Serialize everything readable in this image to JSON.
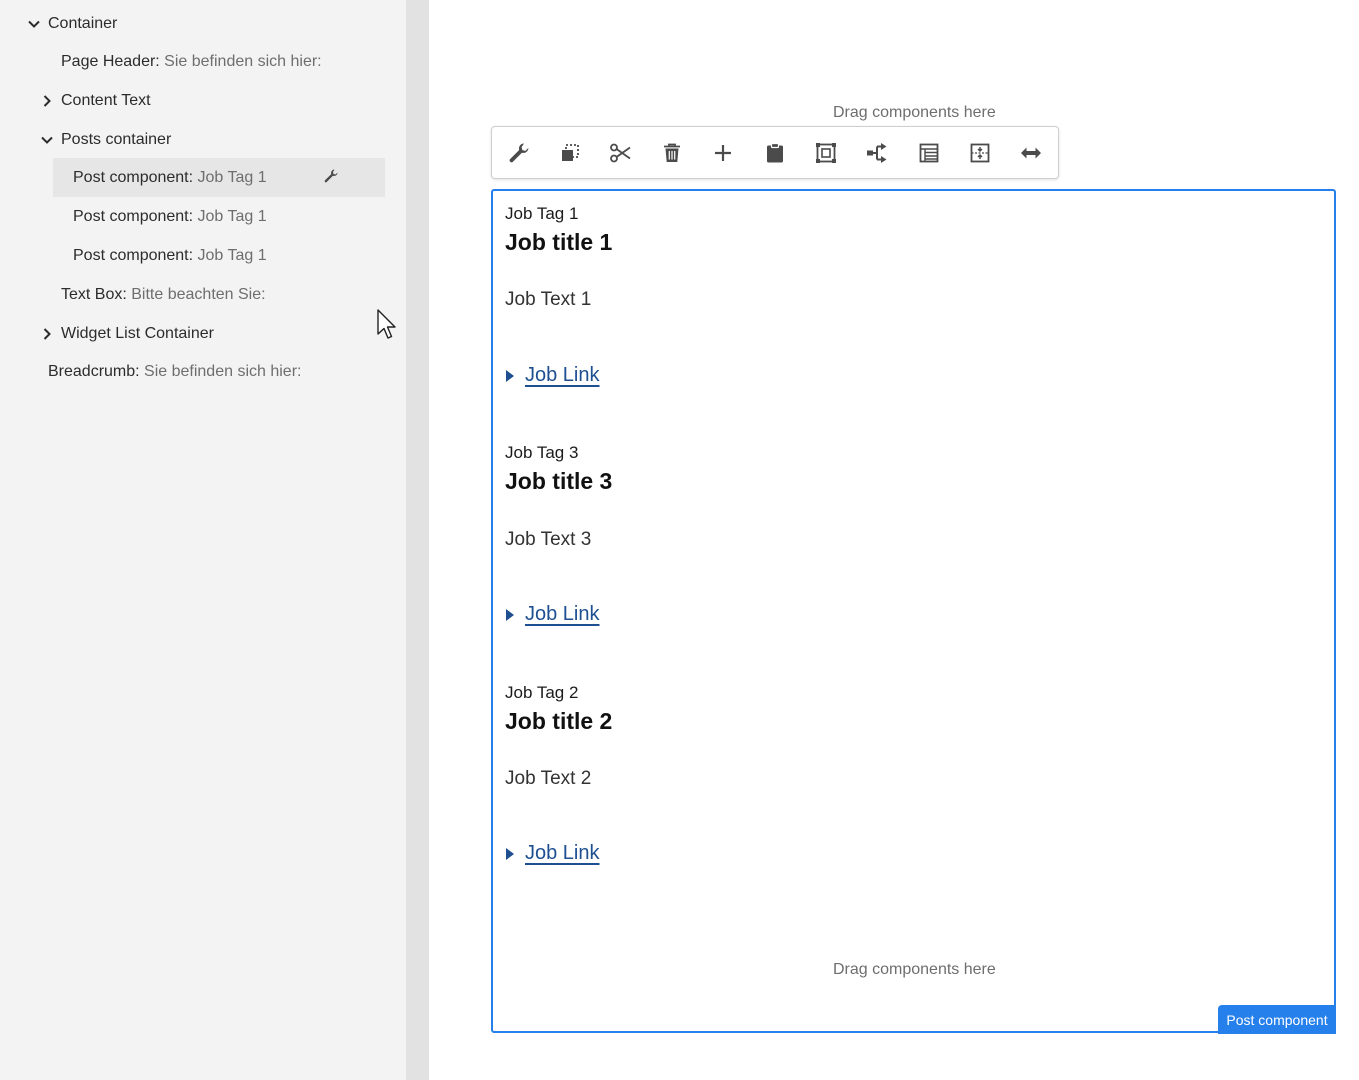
{
  "tree": {
    "rows": [
      {
        "name": "Container",
        "sub": ""
      },
      {
        "name": "Page Header:",
        "sub": " Sie befinden sich hier:"
      },
      {
        "name": "Content Text",
        "sub": ""
      },
      {
        "name": "Posts container",
        "sub": ""
      },
      {
        "name": "Post component:",
        "sub": " Job Tag 1"
      },
      {
        "name": "Post component:",
        "sub": " Job Tag 1"
      },
      {
        "name": "Post component:",
        "sub": " Job Tag 1"
      },
      {
        "name": "Text Box:",
        "sub": " Bitte beachten Sie:"
      },
      {
        "name": "Widget List Container",
        "sub": ""
      },
      {
        "name": "Breadcrumb:",
        "sub": " Sie befinden sich hier:"
      }
    ]
  },
  "editor": {
    "drag_top": "Drag components here",
    "drag_bottom": "Drag components here",
    "badge": "Post component",
    "toolbar_icons": [
      "wrench-icon",
      "copy-icon",
      "cut-icon",
      "delete-icon",
      "add-icon",
      "paste-icon",
      "group-icon",
      "parent-icon",
      "layout-icon",
      "insert-icon",
      "resize-icon"
    ]
  },
  "posts": [
    {
      "tag": "Job Tag 1",
      "title": "Job title 1",
      "text": "Job Text 1",
      "link": "Job Link"
    },
    {
      "tag": "Job Tag 3",
      "title": "Job title 3",
      "text": "Job Text 3",
      "link": "Job Link"
    },
    {
      "tag": "Job Tag 2",
      "title": "Job title 2",
      "text": "Job Text 2",
      "link": "Job Link"
    }
  ],
  "colors": {
    "accent": "#2680eb",
    "link": "#1d4f91"
  }
}
